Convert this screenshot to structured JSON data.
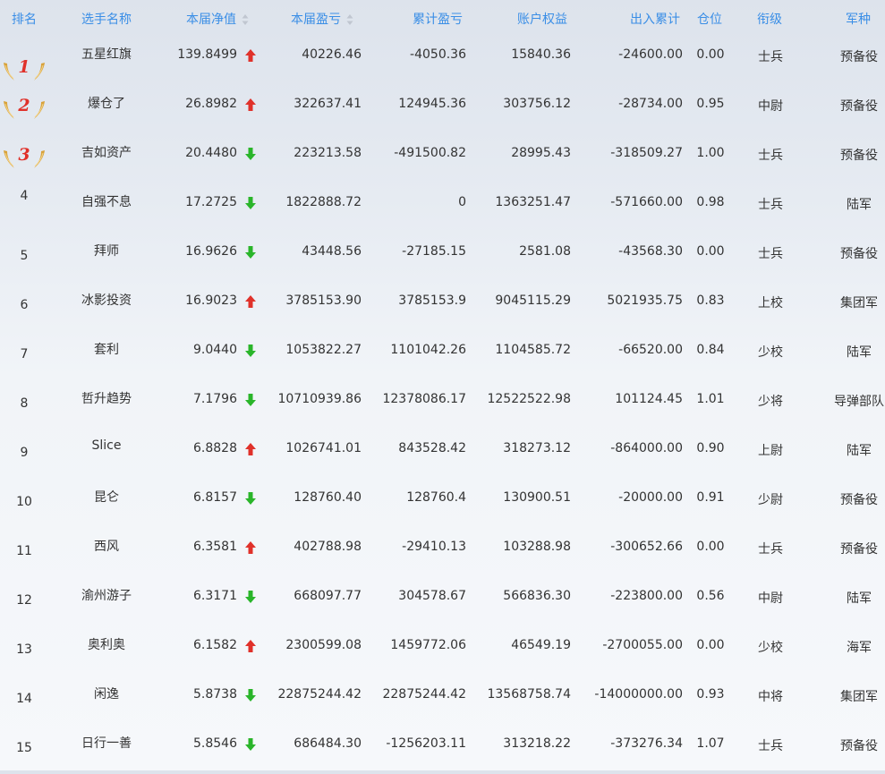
{
  "colors": {
    "header_text": "#3a8ee6",
    "up_arrow": "#e0312a",
    "down_arrow": "#2ab52a",
    "medal_number": "#e0312a"
  },
  "headers": {
    "rank": "排名",
    "name": "选手名称",
    "nav": "本届净值",
    "pnl": "本届盈亏",
    "cum": "累计盈亏",
    "equity": "账户权益",
    "flow": "出入累计",
    "position": "仓位",
    "military_rank": "衔级",
    "army": "军种"
  },
  "rows": [
    {
      "rank": "1",
      "medal": true,
      "name": "五星红旗",
      "nav": "139.8499",
      "trend": "up",
      "pnl": "40226.46",
      "cum": "-4050.36",
      "equity": "15840.36",
      "flow": "-24600.00",
      "position": "0.00",
      "military_rank": "士兵",
      "army": "预备役"
    },
    {
      "rank": "2",
      "medal": true,
      "name": "爆仓了",
      "nav": "26.8982",
      "trend": "up",
      "pnl": "322637.41",
      "cum": "124945.36",
      "equity": "303756.12",
      "flow": "-28734.00",
      "position": "0.95",
      "military_rank": "中尉",
      "army": "预备役"
    },
    {
      "rank": "3",
      "medal": true,
      "name": "吉如资产",
      "nav": "20.4480",
      "trend": "down",
      "pnl": "223213.58",
      "cum": "-491500.82",
      "equity": "28995.43",
      "flow": "-318509.27",
      "position": "1.00",
      "military_rank": "士兵",
      "army": "预备役"
    },
    {
      "rank": "4",
      "medal": false,
      "name": "自强不息",
      "nav": "17.2725",
      "trend": "down",
      "pnl": "1822888.72",
      "cum": "0",
      "equity": "1363251.47",
      "flow": "-571660.00",
      "position": "0.98",
      "military_rank": "士兵",
      "army": "陆军"
    },
    {
      "rank": "5",
      "medal": false,
      "name": "拜师",
      "nav": "16.9626",
      "trend": "down",
      "pnl": "43448.56",
      "cum": "-27185.15",
      "equity": "2581.08",
      "flow": "-43568.30",
      "position": "0.00",
      "military_rank": "士兵",
      "army": "预备役"
    },
    {
      "rank": "6",
      "medal": false,
      "name": "冰影投资",
      "nav": "16.9023",
      "trend": "up",
      "pnl": "3785153.90",
      "cum": "3785153.9",
      "equity": "9045115.29",
      "flow": "5021935.75",
      "position": "0.83",
      "military_rank": "上校",
      "army": "集团军"
    },
    {
      "rank": "7",
      "medal": false,
      "name": "套利",
      "nav": "9.0440",
      "trend": "down",
      "pnl": "1053822.27",
      "cum": "1101042.26",
      "equity": "1104585.72",
      "flow": "-66520.00",
      "position": "0.84",
      "military_rank": "少校",
      "army": "陆军"
    },
    {
      "rank": "8",
      "medal": false,
      "name": "哲升趋势",
      "nav": "7.1796",
      "trend": "down",
      "pnl": "10710939.86",
      "cum": "12378086.17",
      "equity": "12522522.98",
      "flow": "101124.45",
      "position": "1.01",
      "military_rank": "少将",
      "army": "导弹部队"
    },
    {
      "rank": "9",
      "medal": false,
      "name": "Slice",
      "nav": "6.8828",
      "trend": "up",
      "pnl": "1026741.01",
      "cum": "843528.42",
      "equity": "318273.12",
      "flow": "-864000.00",
      "position": "0.90",
      "military_rank": "上尉",
      "army": "陆军"
    },
    {
      "rank": "10",
      "medal": false,
      "name": "昆仑",
      "nav": "6.8157",
      "trend": "down",
      "pnl": "128760.40",
      "cum": "128760.4",
      "equity": "130900.51",
      "flow": "-20000.00",
      "position": "0.91",
      "military_rank": "少尉",
      "army": "预备役"
    },
    {
      "rank": "11",
      "medal": false,
      "name": "西风",
      "nav": "6.3581",
      "trend": "up",
      "pnl": "402788.98",
      "cum": "-29410.13",
      "equity": "103288.98",
      "flow": "-300652.66",
      "position": "0.00",
      "military_rank": "士兵",
      "army": "预备役"
    },
    {
      "rank": "12",
      "medal": false,
      "name": "渝州游子",
      "nav": "6.3171",
      "trend": "down",
      "pnl": "668097.77",
      "cum": "304578.67",
      "equity": "566836.30",
      "flow": "-223800.00",
      "position": "0.56",
      "military_rank": "中尉",
      "army": "陆军"
    },
    {
      "rank": "13",
      "medal": false,
      "name": "奥利奥",
      "nav": "6.1582",
      "trend": "up",
      "pnl": "2300599.08",
      "cum": "1459772.06",
      "equity": "46549.19",
      "flow": "-2700055.00",
      "position": "0.00",
      "military_rank": "少校",
      "army": "海军"
    },
    {
      "rank": "14",
      "medal": false,
      "name": "闲逸",
      "nav": "5.8738",
      "trend": "down",
      "pnl": "22875244.42",
      "cum": "22875244.42",
      "equity": "13568758.74",
      "flow": "-14000000.00",
      "position": "0.93",
      "military_rank": "中将",
      "army": "集团军"
    },
    {
      "rank": "15",
      "medal": false,
      "name": "日行一善",
      "nav": "5.8546",
      "trend": "down",
      "pnl": "686484.30",
      "cum": "-1256203.11",
      "equity": "313218.22",
      "flow": "-373276.34",
      "position": "1.07",
      "military_rank": "士兵",
      "army": "预备役"
    }
  ]
}
